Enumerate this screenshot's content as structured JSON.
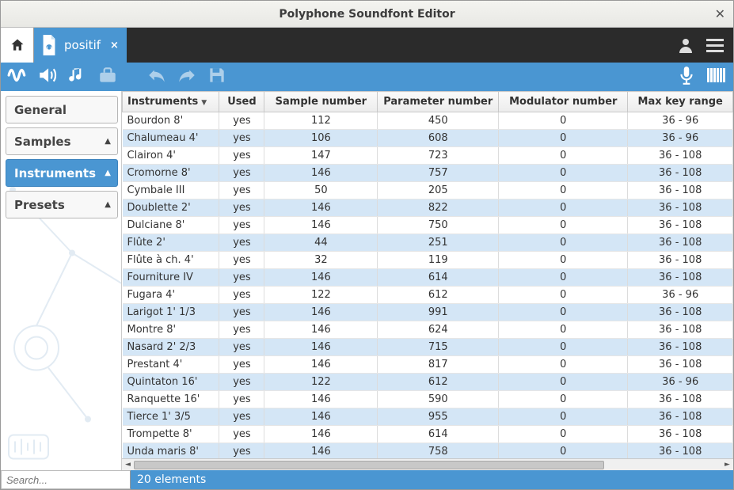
{
  "window": {
    "title": "Polyphone Soundfont Editor"
  },
  "tabs": {
    "file_name": "positif"
  },
  "sidebar": {
    "items": [
      {
        "label": "General",
        "active": false,
        "has_arrow": false
      },
      {
        "label": "Samples",
        "active": false,
        "has_arrow": true
      },
      {
        "label": "Instruments",
        "active": true,
        "has_arrow": true
      },
      {
        "label": "Presets",
        "active": false,
        "has_arrow": true
      }
    ]
  },
  "search": {
    "placeholder": "Search..."
  },
  "status": {
    "text": "20 elements"
  },
  "table": {
    "columns": [
      "Instruments",
      "Used",
      "Sample number",
      "Parameter number",
      "Modulator number",
      "Max key range"
    ],
    "rows": [
      {
        "name": "Bourdon 8'",
        "used": "yes",
        "sample": 112,
        "param": 450,
        "mod": 0,
        "range": "36 - 96"
      },
      {
        "name": "Chalumeau 4'",
        "used": "yes",
        "sample": 106,
        "param": 608,
        "mod": 0,
        "range": "36 - 96"
      },
      {
        "name": "Clairon 4'",
        "used": "yes",
        "sample": 147,
        "param": 723,
        "mod": 0,
        "range": "36 - 108"
      },
      {
        "name": "Cromorne 8'",
        "used": "yes",
        "sample": 146,
        "param": 757,
        "mod": 0,
        "range": "36 - 108"
      },
      {
        "name": "Cymbale III",
        "used": "yes",
        "sample": 50,
        "param": 205,
        "mod": 0,
        "range": "36 - 108"
      },
      {
        "name": "Doublette 2'",
        "used": "yes",
        "sample": 146,
        "param": 822,
        "mod": 0,
        "range": "36 - 108"
      },
      {
        "name": "Dulciane 8'",
        "used": "yes",
        "sample": 146,
        "param": 750,
        "mod": 0,
        "range": "36 - 108"
      },
      {
        "name": "Flûte 2'",
        "used": "yes",
        "sample": 44,
        "param": 251,
        "mod": 0,
        "range": "36 - 108"
      },
      {
        "name": "Flûte à ch. 4'",
        "used": "yes",
        "sample": 32,
        "param": 119,
        "mod": 0,
        "range": "36 - 108"
      },
      {
        "name": "Fourniture IV",
        "used": "yes",
        "sample": 146,
        "param": 614,
        "mod": 0,
        "range": "36 - 108"
      },
      {
        "name": "Fugara 4'",
        "used": "yes",
        "sample": 122,
        "param": 612,
        "mod": 0,
        "range": "36 - 96"
      },
      {
        "name": "Larigot 1' 1/3",
        "used": "yes",
        "sample": 146,
        "param": 991,
        "mod": 0,
        "range": "36 - 108"
      },
      {
        "name": "Montre 8'",
        "used": "yes",
        "sample": 146,
        "param": 624,
        "mod": 0,
        "range": "36 - 108"
      },
      {
        "name": "Nasard 2' 2/3",
        "used": "yes",
        "sample": 146,
        "param": 715,
        "mod": 0,
        "range": "36 - 108"
      },
      {
        "name": "Prestant 4'",
        "used": "yes",
        "sample": 146,
        "param": 817,
        "mod": 0,
        "range": "36 - 108"
      },
      {
        "name": "Quintaton 16'",
        "used": "yes",
        "sample": 122,
        "param": 612,
        "mod": 0,
        "range": "36 - 96"
      },
      {
        "name": "Ranquette 16'",
        "used": "yes",
        "sample": 146,
        "param": 590,
        "mod": 0,
        "range": "36 - 108"
      },
      {
        "name": "Tierce 1' 3/5",
        "used": "yes",
        "sample": 146,
        "param": 955,
        "mod": 0,
        "range": "36 - 108"
      },
      {
        "name": "Trompette 8'",
        "used": "yes",
        "sample": 146,
        "param": 614,
        "mod": 0,
        "range": "36 - 108"
      },
      {
        "name": "Unda maris 8'",
        "used": "yes",
        "sample": 146,
        "param": 758,
        "mod": 0,
        "range": "36 - 108"
      }
    ]
  }
}
